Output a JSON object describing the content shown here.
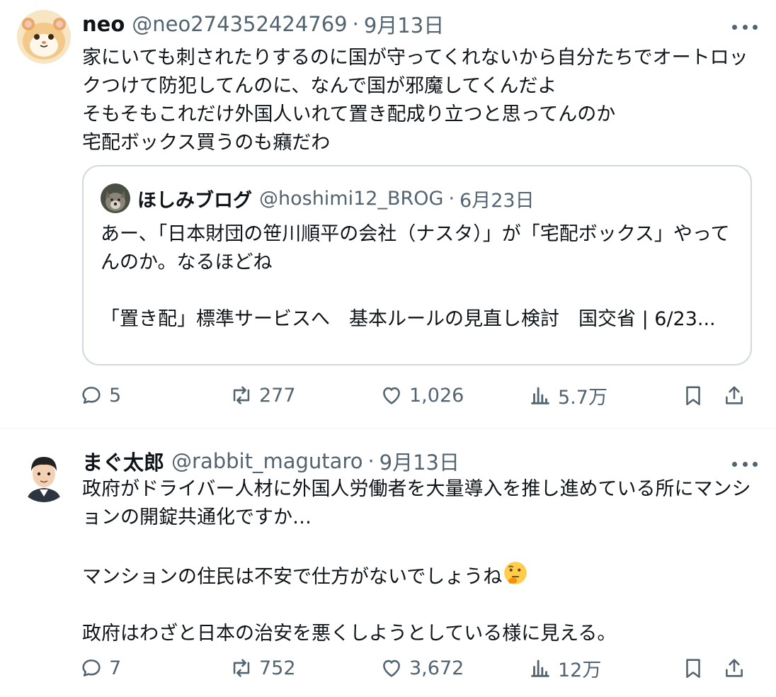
{
  "tweets": [
    {
      "name": "neo",
      "handle": "@neo274352424769",
      "separator": "·",
      "date": "9月13日",
      "text": "家にいても刺されたりするのに国が守ってくれないから自分たちでオートロックつけて防犯してんのに、なんで国が邪魔してくんだよ\nそもそもこれだけ外国人いれて置き配成り立つと思ってんのか\n宅配ボックス買うのも癪だわ",
      "avatar_icon": "hamster-avatar",
      "quote": {
        "name": "ほしみブログ",
        "handle": "@hoshimi12_BROG",
        "separator": "·",
        "date": "6月23日",
        "text": "あー、「日本財団の笹川順平の会社（ナスタ）」が「宅配ボックス」やってんのか。なるほどね\n\n「置き配」標準サービスへ　基本ルールの見直し検討　国交省 | 6/23...",
        "avatar_icon": "wolf-avatar"
      },
      "actions": {
        "replies": "5",
        "reposts": "277",
        "likes": "1,026",
        "views": "5.7万"
      }
    },
    {
      "name": "まぐ太郎",
      "handle": "@rabbit_magutaro",
      "separator": "·",
      "date": "9月13日",
      "text_line1": "政府がドライバー人材に外国人労働者を大量導入を推し進めている所にマンションの開錠共通化ですか…\n\nマンションの住民は不安で仕方がないでしょうね",
      "emoji": "thinking-face-emoji",
      "text_line2": "\n\n政府はわざと日本の治安を悪くしようとしている様に見える。",
      "avatar_icon": "man-cartoon-avatar",
      "actions": {
        "replies": "7",
        "reposts": "752",
        "likes": "3,672",
        "views": "12万"
      }
    }
  ],
  "colors": {
    "text": "#0f1419",
    "secondary": "#536471",
    "border": "#cfd9de",
    "divider": "#eff3f4"
  }
}
